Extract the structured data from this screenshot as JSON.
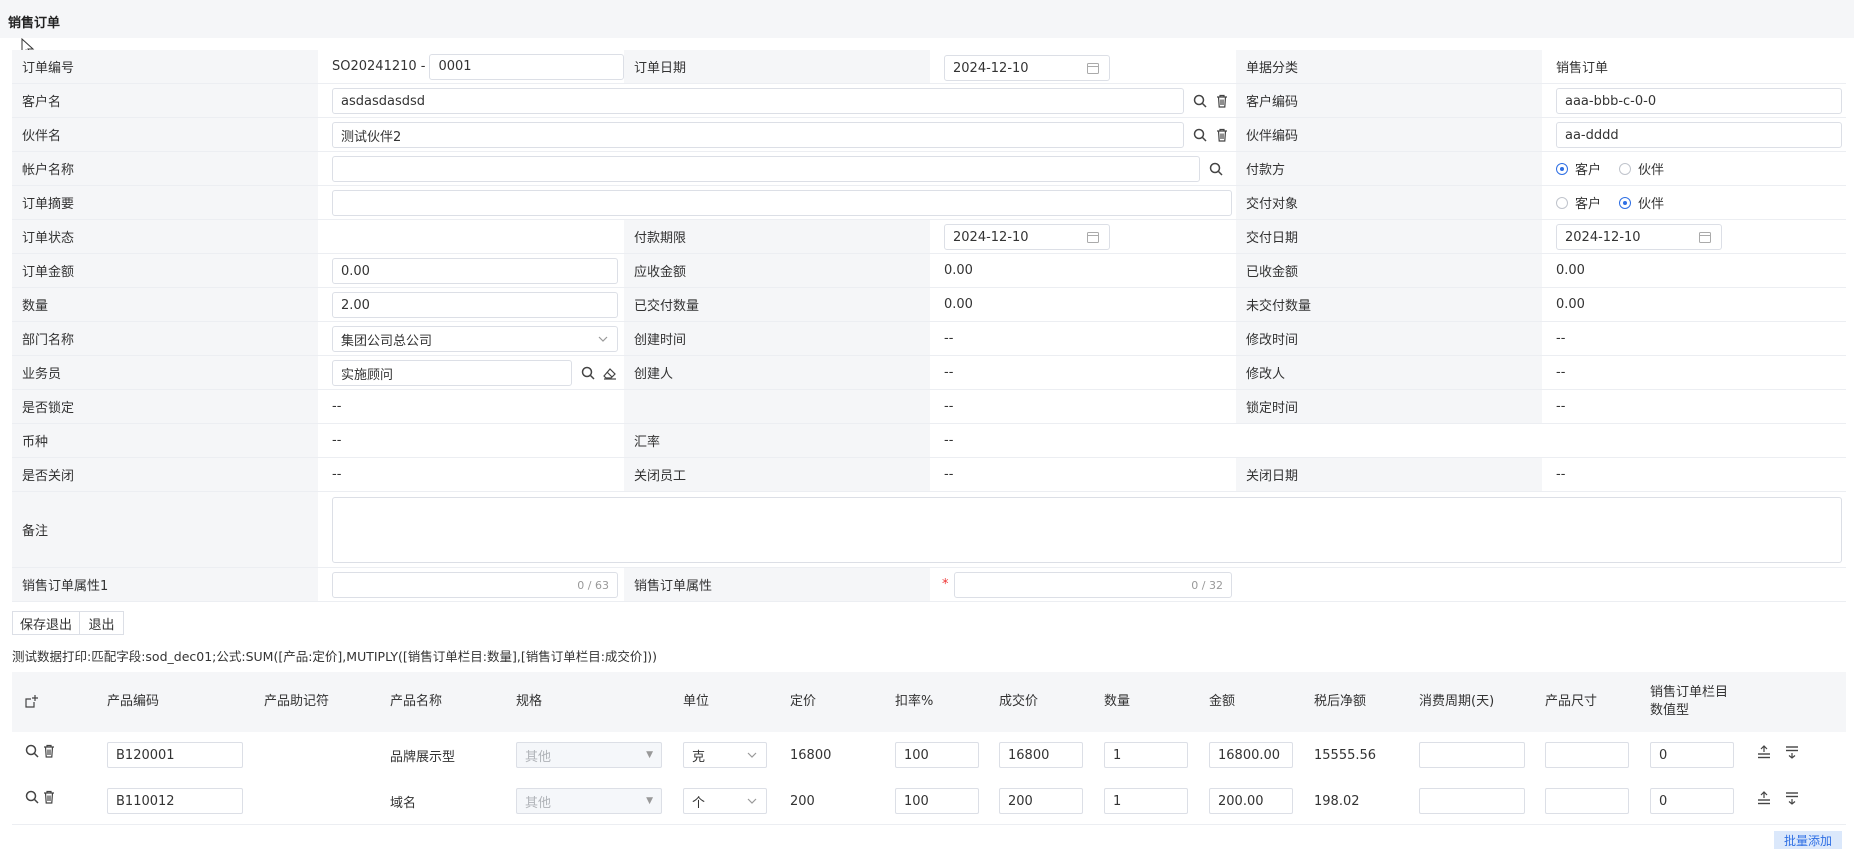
{
  "page_title": "销售订单",
  "form": {
    "order_no": {
      "label": "订单编号",
      "prefix": "SO20241210 -",
      "value": "0001"
    },
    "order_date": {
      "label": "订单日期",
      "value": "2024-12-10"
    },
    "doc_type": {
      "label": "单据分类",
      "value": "销售订单"
    },
    "customer_name": {
      "label": "客户名",
      "value": "asdasdasdsd"
    },
    "customer_code": {
      "label": "客户编码",
      "value": "aaa-bbb-c-0-0"
    },
    "partner_name": {
      "label": "伙伴名",
      "value": "测试伙伴2"
    },
    "partner_code": {
      "label": "伙伴编码",
      "value": "aa-dddd"
    },
    "account_name": {
      "label": "帐户名称",
      "value": ""
    },
    "payer": {
      "label": "付款方",
      "options": [
        "客户",
        "伙伴"
      ],
      "selected": "客户"
    },
    "order_summary": {
      "label": "订单摘要",
      "value": ""
    },
    "deliver_to": {
      "label": "交付对象",
      "options": [
        "客户",
        "伙伴"
      ],
      "selected": "伙伴"
    },
    "order_status": {
      "label": "订单状态",
      "value": ""
    },
    "payment_deadline": {
      "label": "付款期限",
      "value": "2024-12-10"
    },
    "delivery_date": {
      "label": "交付日期",
      "value": "2024-12-10"
    },
    "order_amount": {
      "label": "订单金额",
      "value": "0.00"
    },
    "receivable": {
      "label": "应收金额",
      "value": "0.00"
    },
    "received": {
      "label": "已收金额",
      "value": "0.00"
    },
    "quantity": {
      "label": "数量",
      "value": "2.00"
    },
    "delivered_qty": {
      "label": "已交付数量",
      "value": "0.00"
    },
    "undelivered_qty": {
      "label": "未交付数量",
      "value": "0.00"
    },
    "department": {
      "label": "部门名称",
      "value": "集团公司总公司"
    },
    "created_time": {
      "label": "创建时间",
      "value": "--"
    },
    "modified_time": {
      "label": "修改时间",
      "value": "--"
    },
    "salesperson": {
      "label": "业务员",
      "value": "实施顾问"
    },
    "creator": {
      "label": "创建人",
      "value": "--"
    },
    "modifier": {
      "label": "修改人",
      "value": "--"
    },
    "locked": {
      "label": "是否锁定",
      "value": "--"
    },
    "blank_value": "--",
    "lock_time": {
      "label": "锁定时间",
      "value": "--"
    },
    "currency": {
      "label": "币种",
      "value": "--"
    },
    "exchange_rate": {
      "label": "汇率",
      "value": "--"
    },
    "closed": {
      "label": "是否关闭",
      "value": "--"
    },
    "closed_staff": {
      "label": "关闭员工",
      "value": "--"
    },
    "closed_date": {
      "label": "关闭日期",
      "value": "--"
    },
    "remark": {
      "label": "备注",
      "value": ""
    },
    "attr1": {
      "label": "销售订单属性1",
      "counter": "0 / 63"
    },
    "attr2": {
      "label": "销售订单属性",
      "required": "*",
      "counter": "0 / 32"
    }
  },
  "buttons": {
    "save_exit": "保存退出",
    "exit": "退出"
  },
  "debug_note": "测试数据打印:匹配字段:sod_dec01;公式:SUM([产品:定价],MUTIPLY([销售订单栏目:数量],[销售订单栏目:成交价]))",
  "table": {
    "headers": [
      "产品编码",
      "产品助记符",
      "产品名称",
      "规格",
      "单位",
      "定价",
      "扣率%",
      "成交价",
      "数量",
      "金额",
      "税后净额",
      "消费周期(天)",
      "产品尺寸",
      "销售订单栏目数值型"
    ],
    "header_last_line1": "销售订单栏目",
    "header_last_line2": "数值型",
    "rows": [
      {
        "code": "B120001",
        "mnemonic": "",
        "name": "品牌展示型",
        "spec": "其他",
        "unit": "克",
        "price": "16800",
        "discount": "100",
        "deal_price": "16800",
        "qty": "1",
        "amount": "16800.00",
        "net": "15555.56",
        "period": "",
        "size": "",
        "numeric": "0"
      },
      {
        "code": "B110012",
        "mnemonic": "",
        "name": "域名",
        "spec": "其他",
        "unit": "个",
        "price": "200",
        "discount": "100",
        "deal_price": "200",
        "qty": "1",
        "amount": "200.00",
        "net": "198.02",
        "period": "",
        "size": "",
        "numeric": "0"
      }
    ]
  },
  "batch_add": "批量添加"
}
